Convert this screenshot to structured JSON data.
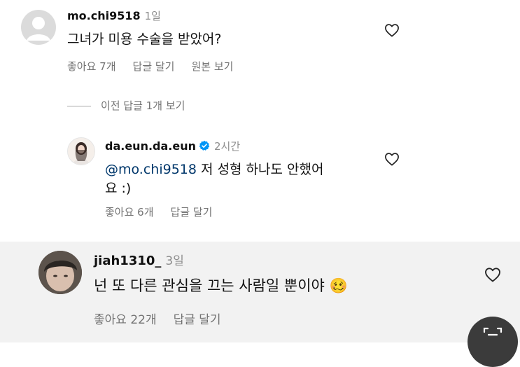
{
  "comments": [
    {
      "username": "mo.chi9518",
      "time": "1일",
      "text": "그녀가 미용 수술을 받았어?",
      "likes": "좋아요 7개",
      "reply_label": "답글 달기",
      "extra_action": "원본 보기"
    },
    {
      "username": "da.eun.da.eun",
      "verified": true,
      "time": "2시간",
      "mention": "@mo.chi9518",
      "text_line1": " 저 성형 하나도 안했어",
      "text_line2": "요 :)",
      "likes": "좋아요 6개",
      "reply_label": "답글 달기"
    },
    {
      "username": "jiah1310_",
      "time": "3일",
      "text": "넌 또 다른 관심을 끄는 사람일 뿐이야",
      "emoji": "🥴",
      "likes": "좋아요 22개",
      "reply_label": "답글 달기"
    }
  ],
  "view_previous_replies": "이전 답글 1개 보기",
  "icons": {
    "like": "heart-outline-icon",
    "verified": "verified-badge-icon",
    "fab": "caption-icon"
  },
  "colors": {
    "mention": "#00376b",
    "verified": "#0095f6",
    "muted": "#737373",
    "highlight": "#f2f2f2"
  }
}
